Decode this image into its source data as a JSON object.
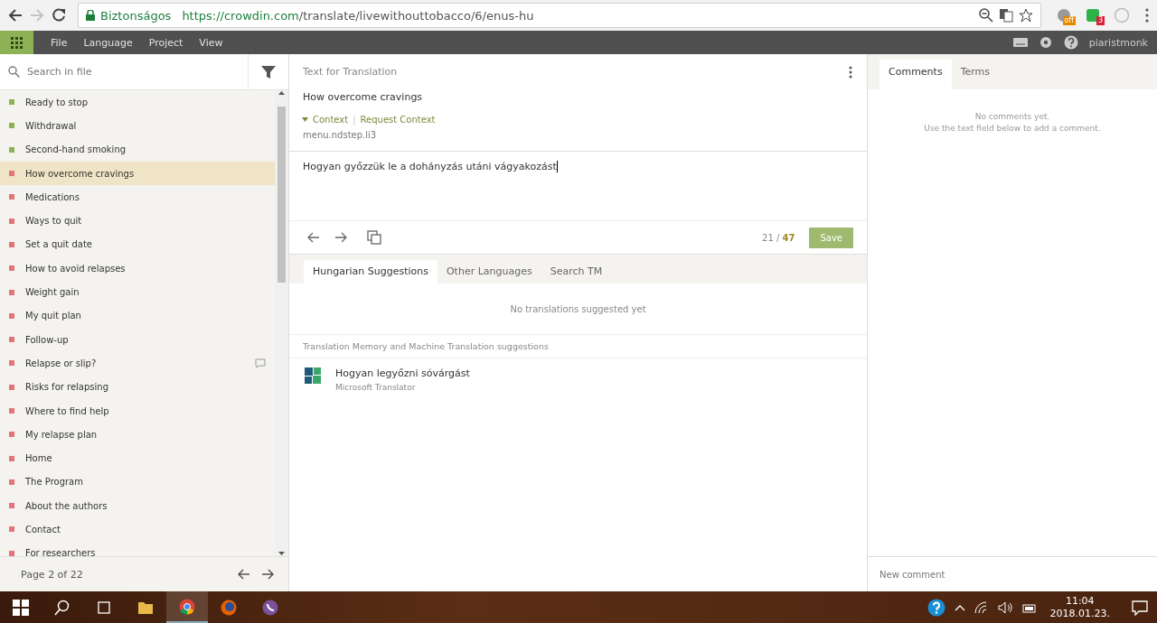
{
  "browser": {
    "security_label": "Biztonságos",
    "url_host": "https://crowdin.com",
    "url_path": "/translate/livewithouttobacco/6/enus-hu",
    "extension_badges": [
      "off",
      "3"
    ]
  },
  "menu": {
    "items": [
      "File",
      "Language",
      "Project",
      "View"
    ],
    "user": "piaristmonk"
  },
  "sidebar": {
    "search_placeholder": "Search in file",
    "items": [
      {
        "label": "Ready to stop",
        "color": "#8db255",
        "selected": false,
        "has_comment": false
      },
      {
        "label": "Withdrawal",
        "color": "#8db255",
        "selected": false,
        "has_comment": false
      },
      {
        "label": "Second-hand smoking",
        "color": "#8db255",
        "selected": false,
        "has_comment": false
      },
      {
        "label": "How overcome cravings",
        "color": "#e5737a",
        "selected": true,
        "has_comment": false
      },
      {
        "label": "Medications",
        "color": "#e5737a",
        "selected": false,
        "has_comment": false
      },
      {
        "label": "Ways to quit",
        "color": "#e5737a",
        "selected": false,
        "has_comment": false
      },
      {
        "label": "Set a quit date",
        "color": "#e5737a",
        "selected": false,
        "has_comment": false
      },
      {
        "label": "How to avoid relapses",
        "color": "#e5737a",
        "selected": false,
        "has_comment": false
      },
      {
        "label": "Weight gain",
        "color": "#e5737a",
        "selected": false,
        "has_comment": false
      },
      {
        "label": "My quit plan",
        "color": "#e5737a",
        "selected": false,
        "has_comment": false
      },
      {
        "label": "Follow-up",
        "color": "#e5737a",
        "selected": false,
        "has_comment": false
      },
      {
        "label": "Relapse or slip?",
        "color": "#e5737a",
        "selected": false,
        "has_comment": true
      },
      {
        "label": "Risks for relapsing",
        "color": "#e5737a",
        "selected": false,
        "has_comment": false
      },
      {
        "label": "Where to find help",
        "color": "#e5737a",
        "selected": false,
        "has_comment": false
      },
      {
        "label": "My relapse plan",
        "color": "#e5737a",
        "selected": false,
        "has_comment": false
      },
      {
        "label": "Home",
        "color": "#e5737a",
        "selected": false,
        "has_comment": false
      },
      {
        "label": "The Program",
        "color": "#e5737a",
        "selected": false,
        "has_comment": false
      },
      {
        "label": "About the authors",
        "color": "#e5737a",
        "selected": false,
        "has_comment": false
      },
      {
        "label": "Contact",
        "color": "#e5737a",
        "selected": false,
        "has_comment": false
      },
      {
        "label": "For researchers",
        "color": "#e5737a",
        "selected": false,
        "has_comment": false
      }
    ],
    "page_label": "Page 2 of 22"
  },
  "editor": {
    "header": "Text for Translation",
    "source_text": "How overcome cravings",
    "context_link": "Context",
    "separator": "|",
    "request_context_link": "Request Context",
    "key": "menu.ndstep.li3",
    "translation": "Hogyan győzzük le a dohányzás utáni vágyakozást",
    "progress_current": "21",
    "progress_separator": "/",
    "progress_total": "47",
    "save_label": "Save"
  },
  "suggestions": {
    "tabs": [
      {
        "label": "Hungarian Suggestions",
        "selected": true
      },
      {
        "label": "Other Languages",
        "selected": false
      },
      {
        "label": "Search TM",
        "selected": false
      }
    ],
    "empty_message": "No translations suggested yet",
    "mt_header": "Translation Memory and Machine Translation suggestions",
    "items": [
      {
        "text": "Hogyan legyőzni sóvárgást",
        "source": "Microsoft Translator"
      }
    ]
  },
  "comments": {
    "tabs": [
      {
        "label": "Comments",
        "selected": true
      },
      {
        "label": "Terms",
        "selected": false
      }
    ],
    "empty_lines": [
      "No comments yet.",
      "Use the text field below to add a comment."
    ],
    "input_placeholder": "New comment"
  },
  "taskbar": {
    "time": "11:04",
    "date": "2018.01.23."
  }
}
